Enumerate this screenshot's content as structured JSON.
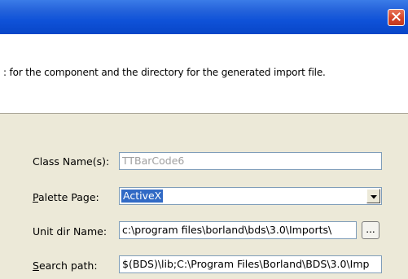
{
  "titlebar": {
    "close_icon": "close-icon"
  },
  "header": {
    "description": ": for the component and the directory for the generated import file."
  },
  "form": {
    "class_name": {
      "label": "Class Name(s):",
      "value": "TTBarCode6"
    },
    "palette_page": {
      "label_accel": "P",
      "label_rest": "alette Page:",
      "value": "ActiveX"
    },
    "unit_dir": {
      "label": "Unit dir Name:",
      "value": "c:\\program files\\borland\\bds\\3.0\\Imports\\",
      "browse_label": "..."
    },
    "search_path": {
      "label_accel": "S",
      "label_rest": "earch path:",
      "value": "$(BDS)\\lib;C:\\Program Files\\Borland\\BDS\\3.0\\Imp"
    }
  },
  "colors": {
    "titlebar": "#0F52D8",
    "close": "#D54428",
    "selection": "#316AC5",
    "dialog_bg": "#ECE9D8"
  }
}
